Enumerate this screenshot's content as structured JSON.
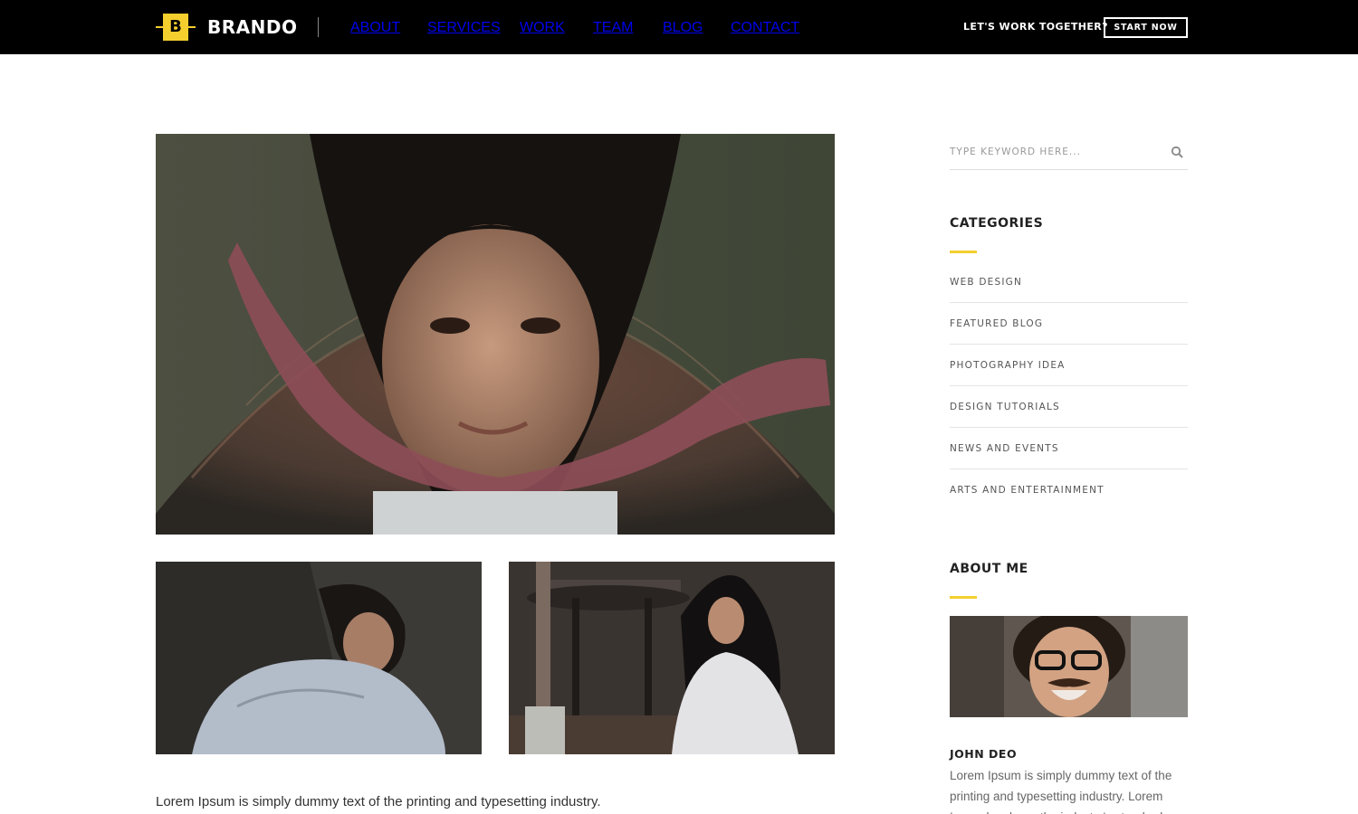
{
  "header": {
    "logo_letter": "B",
    "brand": "BRANDO",
    "nav": [
      "ABOUT",
      "SERVICES",
      "WORK",
      "TEAM",
      "BLOG",
      "CONTACT"
    ],
    "cta_text": "LET'S WORK TOGETHER?",
    "cta_button": "START NOW"
  },
  "main": {
    "body_text": "Lorem Ipsum is simply dummy text of the printing and typesetting industry."
  },
  "sidebar": {
    "search_placeholder": "TYPE KEYWORD HERE...",
    "categories_title": "CATEGORIES",
    "categories": [
      "WEB DESIGN",
      "FEATURED BLOG",
      "PHOTOGRAPHY IDEA",
      "DESIGN TUTORIALS",
      "NEWS AND EVENTS",
      "ARTS AND ENTERTAINMENT"
    ],
    "about_title": "ABOUT ME",
    "about_name": "JOHN DEO",
    "about_text": "Lorem Ipsum is simply dummy text of the printing and typesetting industry. Lorem Ipsum has been the industry's standard"
  },
  "colors": {
    "accent": "#f4cf2e",
    "header_bg": "#000000"
  },
  "icons": {
    "search": "search-icon"
  }
}
